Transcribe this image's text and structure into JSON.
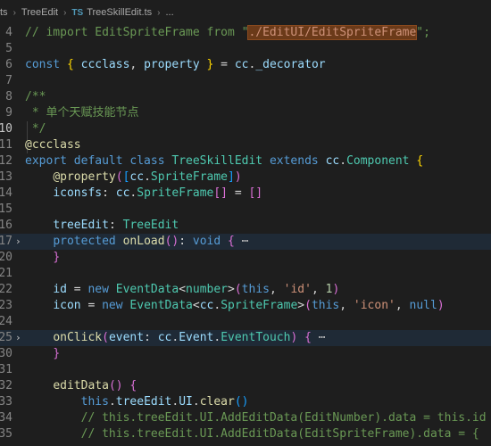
{
  "breadcrumb": {
    "root": "ts",
    "folder": "TreeEdit",
    "file_icon": "TS",
    "file": "TreeSkillEdit.ts",
    "more": "..."
  },
  "lines": [
    {
      "num": "4",
      "tokens": [
        [
          "c-comment",
          "// import EditSpriteFrame from \""
        ],
        [
          "c-str-hl",
          "./EditUI/EditSpriteFrame"
        ],
        [
          "c-comment",
          "\";"
        ]
      ]
    },
    {
      "num": "5",
      "tokens": []
    },
    {
      "num": "6",
      "tokens": [
        [
          "c-kw",
          "const "
        ],
        [
          "c-bracket1",
          "{ "
        ],
        [
          "c-var",
          "ccclass"
        ],
        [
          "c-punc",
          ", "
        ],
        [
          "c-var",
          "property "
        ],
        [
          "c-bracket1",
          "}"
        ],
        [
          "c-punc",
          " = "
        ],
        [
          "c-var",
          "cc"
        ],
        [
          "c-punc",
          "."
        ],
        [
          "c-var",
          "_decorator"
        ]
      ]
    },
    {
      "num": "7",
      "tokens": []
    },
    {
      "num": "8",
      "tokens": [
        [
          "c-comment",
          "/**"
        ]
      ]
    },
    {
      "num": "9",
      "tokens": [
        [
          "c-comment",
          " * 单个天赋技能节点"
        ]
      ]
    },
    {
      "num": "10",
      "active": true,
      "tokens": [
        [
          "c-comment",
          " */"
        ]
      ]
    },
    {
      "num": "11",
      "tokens": [
        [
          "c-fn",
          "@ccclass"
        ]
      ]
    },
    {
      "num": "12",
      "tokens": [
        [
          "c-kw",
          "export default class "
        ],
        [
          "c-type",
          "TreeSkillEdit "
        ],
        [
          "c-kw",
          "extends "
        ],
        [
          "c-var",
          "cc"
        ],
        [
          "c-punc",
          "."
        ],
        [
          "c-type",
          "Component "
        ],
        [
          "c-bracket1",
          "{"
        ]
      ]
    },
    {
      "num": "13",
      "tokens": [
        [
          "c-punc",
          "    "
        ],
        [
          "c-fn",
          "@property"
        ],
        [
          "c-bracket2",
          "("
        ],
        [
          "c-bracket3",
          "["
        ],
        [
          "c-var",
          "cc"
        ],
        [
          "c-punc",
          "."
        ],
        [
          "c-type",
          "SpriteFrame"
        ],
        [
          "c-bracket3",
          "]"
        ],
        [
          "c-bracket2",
          ")"
        ]
      ]
    },
    {
      "num": "14",
      "tokens": [
        [
          "c-punc",
          "    "
        ],
        [
          "c-var",
          "iconsfs"
        ],
        [
          "c-punc",
          ": "
        ],
        [
          "c-var",
          "cc"
        ],
        [
          "c-punc",
          "."
        ],
        [
          "c-type",
          "SpriteFrame"
        ],
        [
          "c-bracket2",
          "[]"
        ],
        [
          "c-punc",
          " = "
        ],
        [
          "c-bracket2",
          "[]"
        ]
      ]
    },
    {
      "num": "15",
      "tokens": []
    },
    {
      "num": "16",
      "tokens": [
        [
          "c-punc",
          "    "
        ],
        [
          "c-var",
          "treeEdit"
        ],
        [
          "c-punc",
          ": "
        ],
        [
          "c-type",
          "TreeEdit"
        ]
      ]
    },
    {
      "num": "17",
      "fold": true,
      "hl": true,
      "tokens": [
        [
          "c-punc",
          "    "
        ],
        [
          "c-kw",
          "protected "
        ],
        [
          "c-fn",
          "onLoad"
        ],
        [
          "c-bracket2",
          "()"
        ],
        [
          "c-punc",
          ": "
        ],
        [
          "c-kw",
          "void "
        ],
        [
          "c-bracket2",
          "{"
        ],
        [
          "c-ell",
          " ⋯"
        ]
      ]
    },
    {
      "num": "20",
      "tokens": [
        [
          "c-punc",
          "    "
        ],
        [
          "c-bracket2",
          "}"
        ]
      ]
    },
    {
      "num": "21",
      "tokens": []
    },
    {
      "num": "22",
      "tokens": [
        [
          "c-punc",
          "    "
        ],
        [
          "c-var",
          "id"
        ],
        [
          "c-punc",
          " = "
        ],
        [
          "c-kw",
          "new "
        ],
        [
          "c-type",
          "EventData"
        ],
        [
          "c-punc",
          "<"
        ],
        [
          "c-type",
          "number"
        ],
        [
          "c-punc",
          ">"
        ],
        [
          "c-bracket2",
          "("
        ],
        [
          "c-kw",
          "this"
        ],
        [
          "c-punc",
          ", "
        ],
        [
          "c-str",
          "'id'"
        ],
        [
          "c-punc",
          ", "
        ],
        [
          "c-num",
          "1"
        ],
        [
          "c-bracket2",
          ")"
        ]
      ]
    },
    {
      "num": "23",
      "tokens": [
        [
          "c-punc",
          "    "
        ],
        [
          "c-var",
          "icon"
        ],
        [
          "c-punc",
          " = "
        ],
        [
          "c-kw",
          "new "
        ],
        [
          "c-type",
          "EventData"
        ],
        [
          "c-punc",
          "<"
        ],
        [
          "c-var",
          "cc"
        ],
        [
          "c-punc",
          "."
        ],
        [
          "c-type",
          "SpriteFrame"
        ],
        [
          "c-punc",
          ">"
        ],
        [
          "c-bracket2",
          "("
        ],
        [
          "c-kw",
          "this"
        ],
        [
          "c-punc",
          ", "
        ],
        [
          "c-str",
          "'icon'"
        ],
        [
          "c-punc",
          ", "
        ],
        [
          "c-kw",
          "null"
        ],
        [
          "c-bracket2",
          ")"
        ]
      ]
    },
    {
      "num": "24",
      "tokens": []
    },
    {
      "num": "25",
      "fold": true,
      "hl": true,
      "tokens": [
        [
          "c-punc",
          "    "
        ],
        [
          "c-fn",
          "onClick"
        ],
        [
          "c-bracket2",
          "("
        ],
        [
          "c-var",
          "event"
        ],
        [
          "c-punc",
          ": "
        ],
        [
          "c-var",
          "cc"
        ],
        [
          "c-punc",
          "."
        ],
        [
          "c-var",
          "Event"
        ],
        [
          "c-punc",
          "."
        ],
        [
          "c-type",
          "EventTouch"
        ],
        [
          "c-bracket2",
          ")"
        ],
        [
          "c-punc",
          " "
        ],
        [
          "c-bracket2",
          "{"
        ],
        [
          "c-ell",
          " ⋯"
        ]
      ]
    },
    {
      "num": "30",
      "tokens": [
        [
          "c-punc",
          "    "
        ],
        [
          "c-bracket2",
          "}"
        ]
      ]
    },
    {
      "num": "31",
      "tokens": []
    },
    {
      "num": "32",
      "tokens": [
        [
          "c-punc",
          "    "
        ],
        [
          "c-fn",
          "editData"
        ],
        [
          "c-bracket2",
          "()"
        ],
        [
          "c-punc",
          " "
        ],
        [
          "c-bracket2",
          "{"
        ]
      ]
    },
    {
      "num": "33",
      "tokens": [
        [
          "c-punc",
          "        "
        ],
        [
          "c-kw",
          "this"
        ],
        [
          "c-punc",
          "."
        ],
        [
          "c-var",
          "treeEdit"
        ],
        [
          "c-punc",
          "."
        ],
        [
          "c-var",
          "UI"
        ],
        [
          "c-punc",
          "."
        ],
        [
          "c-fn",
          "clear"
        ],
        [
          "c-bracket3",
          "()"
        ]
      ]
    },
    {
      "num": "34",
      "tokens": [
        [
          "c-punc",
          "        "
        ],
        [
          "c-comment",
          "// this.treeEdit.UI.AddEditData(EditNumber).data = this.id"
        ]
      ]
    },
    {
      "num": "35",
      "tokens": [
        [
          "c-punc",
          "        "
        ],
        [
          "c-comment",
          "// this.treeEdit.UI.AddEditData(EditSpriteFrame).data = {"
        ]
      ]
    }
  ]
}
